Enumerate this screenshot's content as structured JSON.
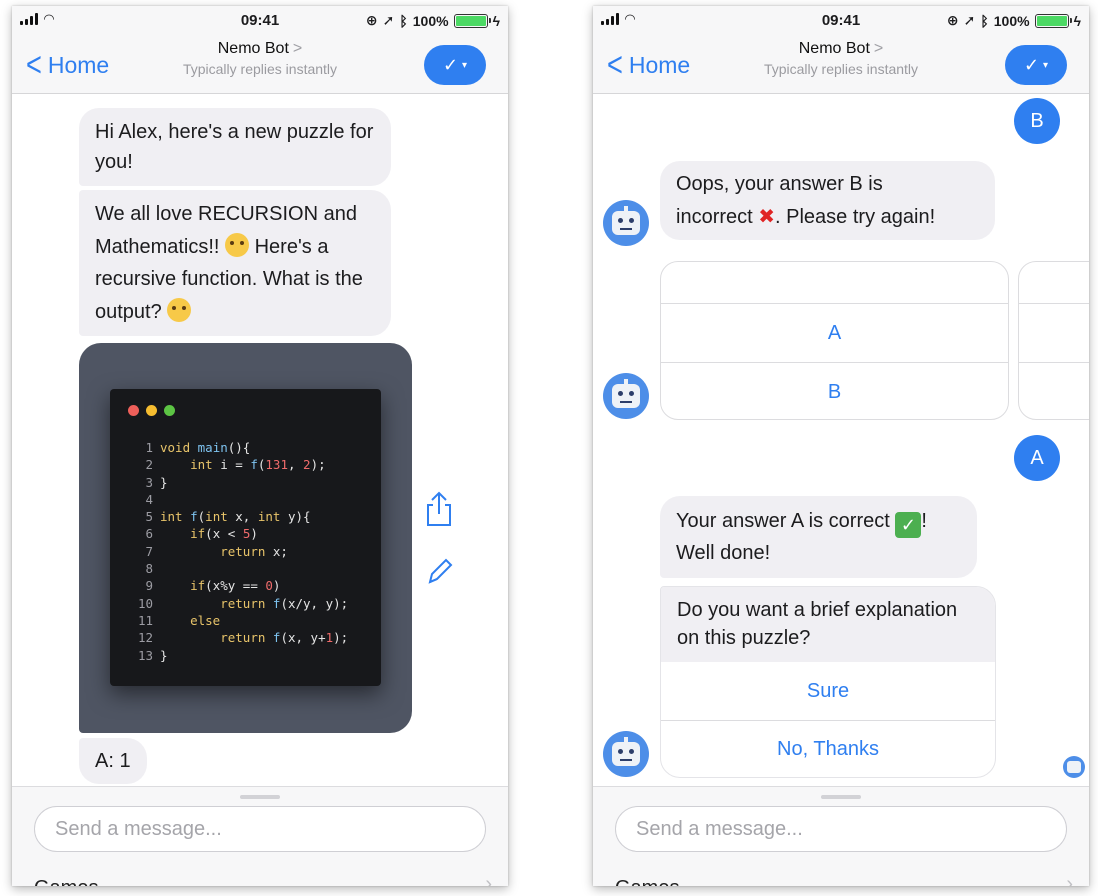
{
  "status_bar": {
    "time": "09:41",
    "battery_text": "100%"
  },
  "nav": {
    "back_label": "Home",
    "title": "Nemo Bot",
    "title_chevron": ">",
    "subtitle": "Typically replies instantly",
    "action_icon": "checkmark-dropdown-icon"
  },
  "left_chat": {
    "messages": [
      "Hi Alex, here's a new puzzle for you!",
      "We all love RECURSION and Mathematics!!",
      "Here's a recursive function. What is the output?"
    ],
    "code_image": {
      "lines": [
        {
          "n": "1",
          "text": "void main(){"
        },
        {
          "n": "2",
          "text": "    int i = f(131, 2);"
        },
        {
          "n": "3",
          "text": "}"
        },
        {
          "n": "4",
          "text": ""
        },
        {
          "n": "5",
          "text": "int f(int x, int y){"
        },
        {
          "n": "6",
          "text": "    if(x < 5)"
        },
        {
          "n": "7",
          "text": "        return x;"
        },
        {
          "n": "8",
          "text": ""
        },
        {
          "n": "9",
          "text": "    if(x%y == 0)"
        },
        {
          "n": "10",
          "text": "        return f(x/y, y);"
        },
        {
          "n": "11",
          "text": "    else"
        },
        {
          "n": "12",
          "text": "        return f(x, y+1);"
        },
        {
          "n": "13",
          "text": "}"
        }
      ]
    },
    "answer": "A: 1",
    "share_icon": "share-icon",
    "edit_icon": "pencil-icon"
  },
  "right_chat": {
    "user_reply_1": "B",
    "bot_incorrect_1": "Oops, your answer B is",
    "bot_incorrect_2": "incorrect",
    "bot_incorrect_3": ". Please try again!",
    "options": [
      "A",
      "B"
    ],
    "user_reply_2": "A",
    "bot_correct_1": "Your answer A is correct",
    "bot_correct_2": "!",
    "bot_correct_3": "Well done!",
    "explanation_prompt": "Do you want a brief explanation on this puzzle?",
    "quick_replies": [
      "Sure",
      "No, Thanks"
    ]
  },
  "composer": {
    "placeholder": "Send a message...",
    "games_label": "Games"
  },
  "colors": {
    "accent": "#2f7ff0",
    "bubble": "#f0eff3",
    "code_bg": "#17181b"
  }
}
